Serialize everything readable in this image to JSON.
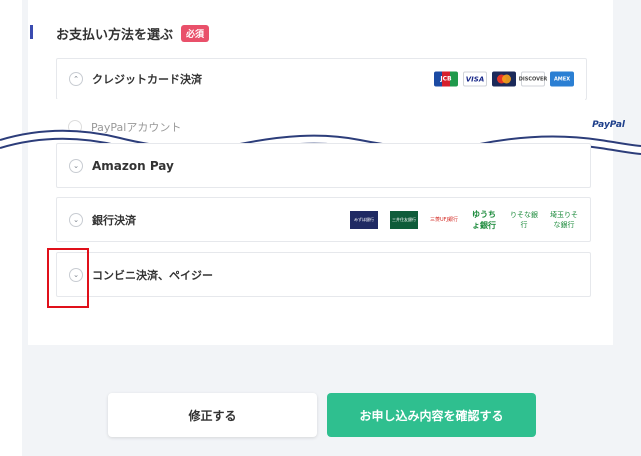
{
  "section": {
    "title": "お支払い方法を選ぶ",
    "required_badge": "必須"
  },
  "options": {
    "credit": {
      "label": "クレジットカード決済",
      "expanded": true,
      "logos": [
        "JCB",
        "VISA",
        "MasterCard",
        "DISCOVER",
        "AMEX"
      ]
    },
    "paypal": {
      "label": "PayPalアカウント",
      "logo": "PayPal"
    },
    "amazon": {
      "label": "Amazon Pay"
    },
    "bank": {
      "label": "銀行決済",
      "logos": [
        "みずほ銀行",
        "三井住友銀行",
        "三菱UFJ銀行",
        "ゆうちょ銀行",
        "りそな銀行",
        "埼玉りそな銀行"
      ]
    },
    "convenience": {
      "label": "コンビニ決済、ペイジー"
    }
  },
  "buttons": {
    "back": "修正する",
    "confirm": "お申し込み内容を確認する"
  },
  "colors": {
    "accent": "#2fbf8f",
    "required": "#e9506a",
    "highlight": "#e0101a"
  }
}
